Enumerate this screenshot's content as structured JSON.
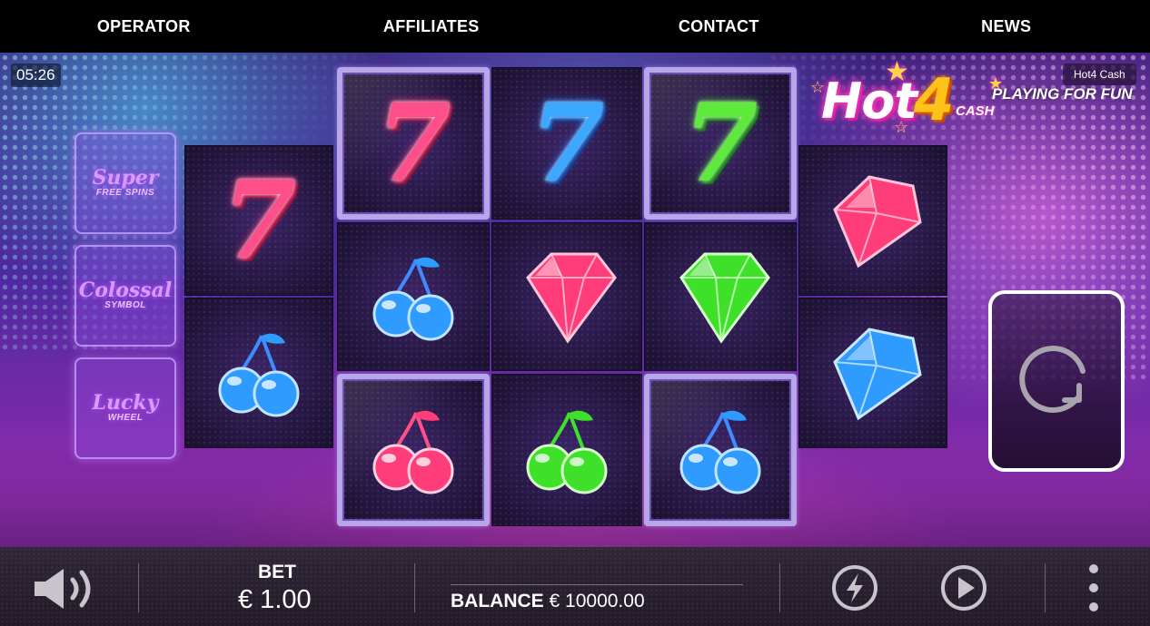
{
  "nav": {
    "items": [
      "OPERATOR",
      "AFFILIATES",
      "CONTACT",
      "NEWS"
    ]
  },
  "game": {
    "clock": "05:26",
    "name": "Hot4 Cash",
    "mode": "PLAYING FOR FUN",
    "logo": {
      "hot": "Hot",
      "four": "4",
      "cash": "CASH"
    }
  },
  "features": [
    {
      "big": "Super",
      "small": "FREE SPINS"
    },
    {
      "big": "Colossal",
      "small": "SYMBOL"
    },
    {
      "big": "Lucky",
      "small": "WHEEL"
    }
  ],
  "reels": [
    [
      "seven-red",
      "cherry-blue"
    ],
    [
      "seven-red",
      "cherry-blue",
      "cherry-red"
    ],
    [
      "seven-blue",
      "diamond-red",
      "cherry-green"
    ],
    [
      "seven-green",
      "diamond-green",
      "cherry-blue"
    ],
    [
      "diamond-red",
      "diamond-blue"
    ]
  ],
  "bottom": {
    "bet_label": "BET",
    "bet_value": "€ 1.00",
    "balance_label": "BALANCE",
    "balance_value": "€ 10000.00"
  },
  "colors": {
    "nav_bg": "#000000",
    "bottom_bg": "#2a2230",
    "spin_border": "#ffffff",
    "red": "#ff3d7a",
    "blue": "#2f9bff",
    "green": "#3ee02a"
  },
  "icons": [
    "speaker-icon",
    "spin-arrow-icon",
    "turbo-lightning-icon",
    "autoplay-play-icon",
    "more-menu-icon"
  ]
}
